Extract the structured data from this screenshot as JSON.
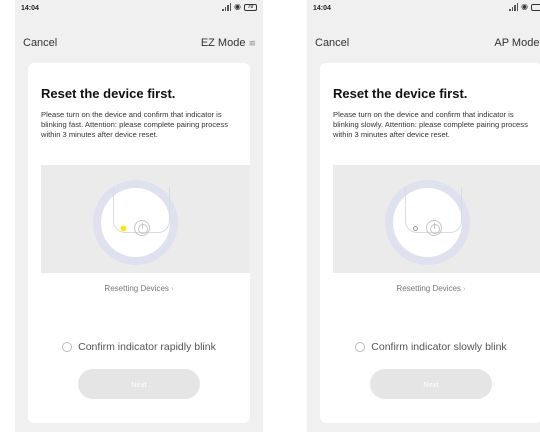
{
  "screens": [
    {
      "status_bar": {
        "time": "14:04",
        "battery": "70"
      },
      "nav": {
        "cancel_label": "Cancel",
        "mode_label": "EZ Mode"
      },
      "card": {
        "title": "Reset the device first.",
        "description": "Please turn on the device and confirm that indicator is blinking fast. Attention: please complete pairing process within 3 minutes after device reset.",
        "indicator_state": "lit",
        "indicator_color": "#f4e21a",
        "resetting_link": "Resetting Devices",
        "confirm_label": "Confirm indicator rapidly blink",
        "next_label": "Next"
      }
    },
    {
      "status_bar": {
        "time": "14:04",
        "battery": ""
      },
      "nav": {
        "cancel_label": "Cancel",
        "mode_label": "AP Mode"
      },
      "card": {
        "title": "Reset the device first.",
        "description": "Please turn on the device and confirm that indicator is blinking slowly. Attention: please complete pairing process within 3 minutes after device reset.",
        "indicator_state": "off",
        "indicator_color": "#ffffff",
        "resetting_link": "Resetting Devices",
        "confirm_label": "Confirm indicator slowly blink",
        "next_label": "Next"
      }
    }
  ],
  "icons": {
    "mode_switch": "swap-arrows-icon",
    "resetting_chevron": "chevron-right-icon",
    "radio": "radio-unchecked-icon",
    "power": "power-icon",
    "signal": "signal-icon",
    "wifi": "wifi-icon",
    "battery": "battery-icon"
  },
  "colors": {
    "background": "#f0f0f0",
    "card": "#ffffff",
    "next_button_disabled": "#e5e5e5",
    "device_ring": "#dde2ee"
  }
}
